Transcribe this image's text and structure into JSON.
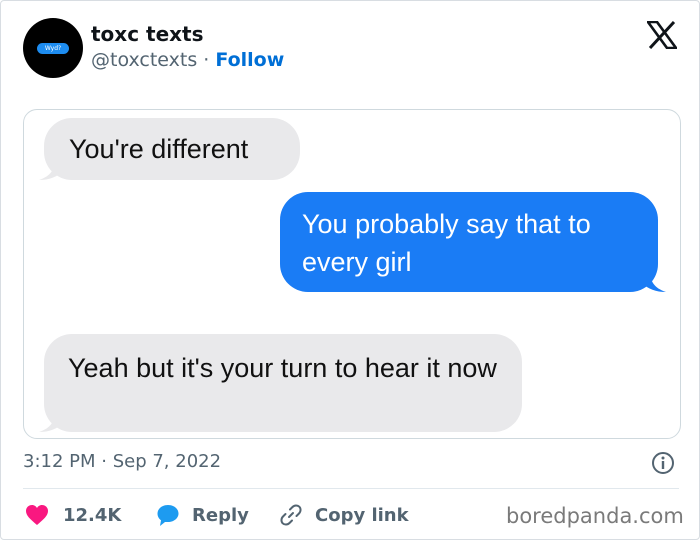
{
  "tweet": {
    "author": {
      "name": "toxc texts",
      "handle": "@toxctexts",
      "separator": "·",
      "follow_label": "Follow",
      "avatar_text": "Wyd?"
    },
    "platform_icon": "x-logo-icon",
    "messages": [
      {
        "side": "received",
        "text": "You're different"
      },
      {
        "side": "sent",
        "text": "You probably say that to every girl"
      },
      {
        "side": "received",
        "text": "Yeah but it's your turn to hear it now"
      }
    ],
    "timestamp": "3:12 PM · Sep 7, 2022",
    "actions": {
      "like_count": "12.4K",
      "reply_label": "Reply",
      "copy_link_label": "Copy link"
    },
    "watermark": "boredpanda.com"
  },
  "colors": {
    "follow_blue": "#006fd6",
    "bubble_sent": "#1a7cf5",
    "bubble_received": "#e9e9eb",
    "like_heart": "#f91880",
    "reply_icon": "#1d9bf0",
    "muted_text": "#536471"
  }
}
